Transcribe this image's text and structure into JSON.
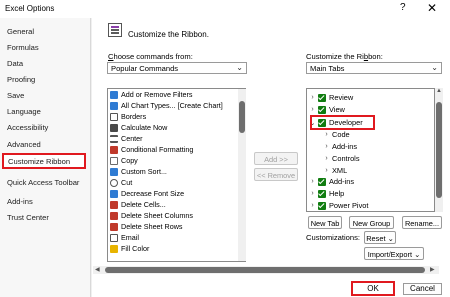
{
  "window": {
    "title": "Excel Options",
    "help_glyph": "?",
    "close_glyph": "✕"
  },
  "sidebar": {
    "items": [
      {
        "label": "General"
      },
      {
        "label": "Formulas"
      },
      {
        "label": "Data"
      },
      {
        "label": "Proofing"
      },
      {
        "label": "Save"
      },
      {
        "label": "Language"
      },
      {
        "label": "Accessibility"
      },
      {
        "label": "Advanced"
      },
      {
        "label": "Customize Ribbon",
        "active": true
      },
      {
        "label": "Quick Access Toolbar"
      },
      {
        "label": "Add-ins"
      },
      {
        "label": "Trust Center"
      }
    ]
  },
  "main": {
    "title": "Customize the Ribbon.",
    "choose_label_pre": "",
    "choose_label_u": "C",
    "choose_label_post": "hoose commands from:",
    "choose_value": "Popular Commands",
    "ribbon_label_pre": "Customize the Ri",
    "ribbon_label_u": "b",
    "ribbon_label_post": "bon:",
    "ribbon_value": "Main Tabs",
    "commands": [
      {
        "label": "Add or Remove Filters",
        "icon_color": "#2f7bd3"
      },
      {
        "label": "All Chart Types... [Create Chart]",
        "icon_color": "#2f7bd3"
      },
      {
        "label": "Borders",
        "icon_color": "#555555"
      },
      {
        "label": "Calculate Now",
        "icon_color": "#4a4a4a"
      },
      {
        "label": "Center",
        "icon_color": "#555555"
      },
      {
        "label": "Conditional Formatting",
        "icon_color": "#c0392b"
      },
      {
        "label": "Copy",
        "icon_color": "#6b6b6b"
      },
      {
        "label": "Custom Sort...",
        "icon_color": "#2f7bd3"
      },
      {
        "label": "Cut",
        "icon_color": "#555555"
      },
      {
        "label": "Decrease Font Size",
        "icon_color": "#2f7bd3"
      },
      {
        "label": "Delete Cells...",
        "icon_color": "#c0392b"
      },
      {
        "label": "Delete Sheet Columns",
        "icon_color": "#c0392b"
      },
      {
        "label": "Delete Sheet Rows",
        "icon_color": "#c0392b"
      },
      {
        "label": "Email",
        "icon_color": "#555555"
      },
      {
        "label": "Fill Color",
        "icon_color": "#e8b400"
      }
    ],
    "add_button": "Add >>",
    "remove_button": "<< Remove",
    "tabs_tree": [
      {
        "label": "Review",
        "checked": true,
        "expander": "›",
        "level": 0
      },
      {
        "label": "View",
        "checked": true,
        "expander": "›",
        "level": 0
      },
      {
        "label": "Developer",
        "checked": true,
        "expander": "⌄",
        "level": 0
      },
      {
        "label": "Code",
        "checked": false,
        "expander": "›",
        "level": 1
      },
      {
        "label": "Add-ins",
        "checked": false,
        "expander": "›",
        "level": 1
      },
      {
        "label": "Controls",
        "checked": false,
        "expander": "›",
        "level": 1
      },
      {
        "label": "XML",
        "checked": false,
        "expander": "›",
        "level": 1
      },
      {
        "label": "Add-ins",
        "checked": true,
        "expander": "›",
        "level": 0
      },
      {
        "label": "Help",
        "checked": true,
        "expander": "›",
        "level": 0
      },
      {
        "label": "Power Pivot",
        "checked": true,
        "expander": "›",
        "level": 0
      }
    ],
    "new_tab_button": "New Tab",
    "new_group_button": "New Group",
    "rename_button": "Rename...",
    "customizations_label": "Customizations:",
    "reset_button": "Reset",
    "import_export_button": "Import/Export",
    "dropdown_glyph": "⌄"
  },
  "footer": {
    "ok_button": "OK",
    "cancel_button": "Cancel"
  },
  "colors": {
    "highlight": "#e0191f",
    "checkbox": "#107c10"
  }
}
